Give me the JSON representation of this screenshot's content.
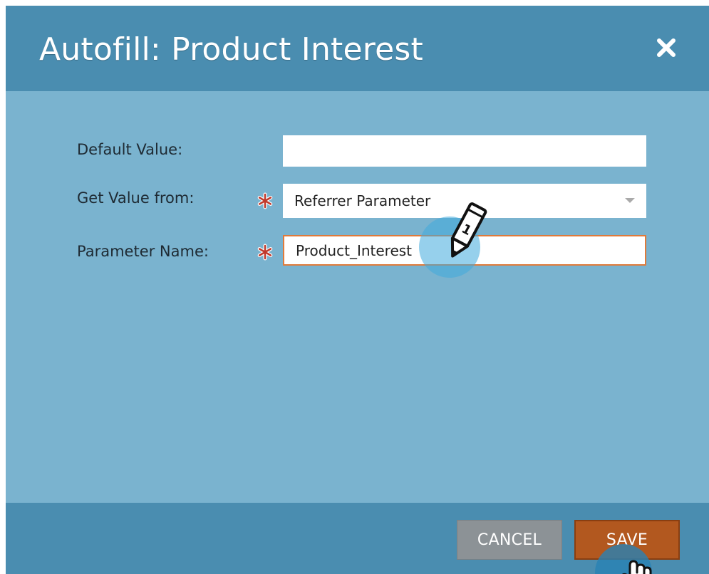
{
  "dialog": {
    "title": "Autofill: Product Interest"
  },
  "form": {
    "default_value": {
      "label": "Default Value:",
      "value": ""
    },
    "get_value_from": {
      "label": "Get Value from:",
      "selected": "Referrer Parameter"
    },
    "parameter_name": {
      "label": "Parameter Name:",
      "value": "Product_Interest"
    }
  },
  "annotation": {
    "step_number": "1"
  },
  "buttons": {
    "cancel_label": "CANCEL",
    "save_label": "SAVE"
  },
  "colors": {
    "header": "#4a8db0",
    "body": "#7ab3cf",
    "required": "#c0392b",
    "focus_border": "#e07a3a",
    "save": "#b2581f",
    "cancel": "#8c9296"
  },
  "icons": [
    "close-icon",
    "required-star-icon",
    "chevron-down-icon",
    "pencil-icon",
    "hand-cursor-icon"
  ]
}
